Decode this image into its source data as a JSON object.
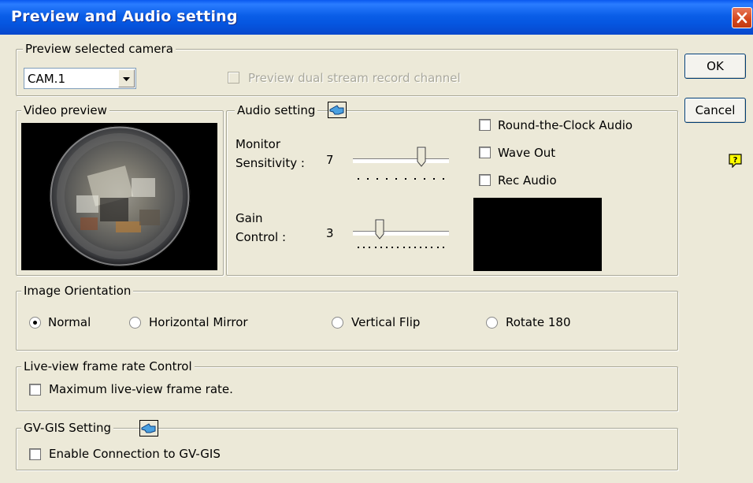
{
  "window": {
    "title": "Preview and Audio setting"
  },
  "preview_camera": {
    "legend": "Preview selected camera",
    "camera_select": "CAM.1",
    "dual_stream_label": "Preview dual stream record channel"
  },
  "video": {
    "legend": "Video preview"
  },
  "audio": {
    "legend": "Audio setting",
    "monitor_label_1": "Monitor",
    "monitor_label_2": "Sensitivity :",
    "monitor_value": "7",
    "monitor_level": 7,
    "gain_label_1": "Gain",
    "gain_label_2": "Control :",
    "gain_value": "3",
    "gain_level": 3,
    "round_clock": "Round-the-Clock Audio",
    "wave_out": "Wave Out",
    "rec_audio": "Rec Audio"
  },
  "orientation": {
    "legend": "Image Orientation",
    "options": [
      "Normal",
      "Horizontal Mirror",
      "Vertical Flip",
      "Rotate 180"
    ],
    "selected": "Normal"
  },
  "framerate": {
    "legend": "Live-view frame rate Control",
    "max_label": "Maximum live-view frame rate."
  },
  "gis": {
    "legend": "GV-GIS Setting",
    "enable_label": "Enable Connection to GV-GIS"
  },
  "buttons": {
    "ok": "OK",
    "cancel": "Cancel"
  },
  "icons": {
    "help": "help-icon",
    "settings_hand": "pointing-hand-icon",
    "close": "close-icon"
  }
}
